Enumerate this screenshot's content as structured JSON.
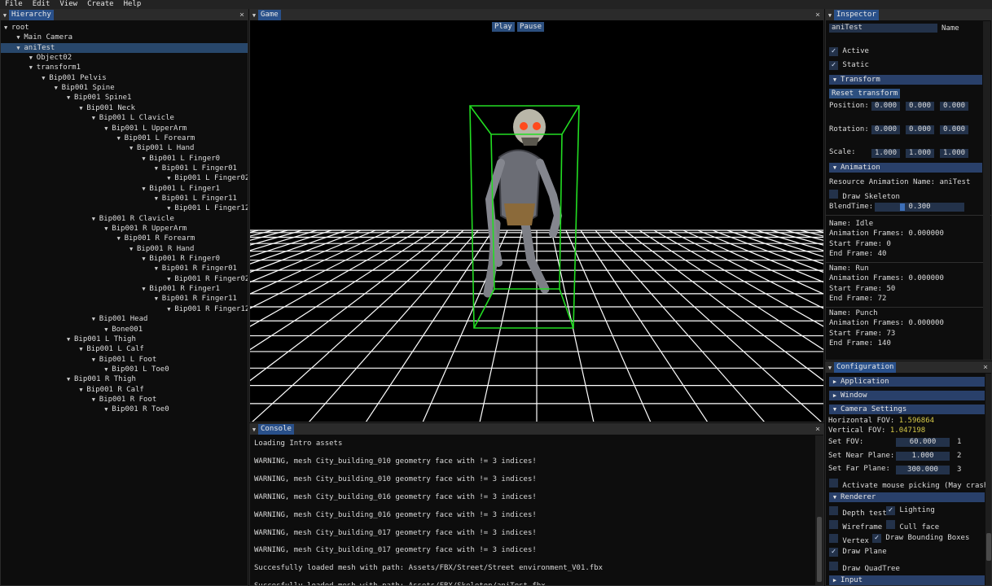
{
  "menu": [
    "File",
    "Edit",
    "View",
    "Create",
    "Help"
  ],
  "hierarchy": {
    "title": "Hierarchy",
    "nodes": [
      {
        "label": "root",
        "depth": 0
      },
      {
        "label": "Main Camera",
        "depth": 1
      },
      {
        "label": "aniTest",
        "depth": 1,
        "selected": true
      },
      {
        "label": "Object02",
        "depth": 2
      },
      {
        "label": "transform1",
        "depth": 2
      },
      {
        "label": "Bip001 Pelvis",
        "depth": 3
      },
      {
        "label": "Bip001 Spine",
        "depth": 4
      },
      {
        "label": "Bip001 Spine1",
        "depth": 5
      },
      {
        "label": "Bip001 Neck",
        "depth": 6
      },
      {
        "label": "Bip001 L Clavicle",
        "depth": 7
      },
      {
        "label": "Bip001 L UpperArm",
        "depth": 8
      },
      {
        "label": "Bip001 L Forearm",
        "depth": 9
      },
      {
        "label": "Bip001 L Hand",
        "depth": 10
      },
      {
        "label": "Bip001 L Finger0",
        "depth": 11
      },
      {
        "label": "Bip001 L Finger01",
        "depth": 12
      },
      {
        "label": "Bip001 L Finger02",
        "depth": 13
      },
      {
        "label": "Bip001 L Finger1",
        "depth": 11
      },
      {
        "label": "Bip001 L Finger11",
        "depth": 12
      },
      {
        "label": "Bip001 L Finger12",
        "depth": 13
      },
      {
        "label": "Bip001 R Clavicle",
        "depth": 7
      },
      {
        "label": "Bip001 R UpperArm",
        "depth": 8
      },
      {
        "label": "Bip001 R Forearm",
        "depth": 9
      },
      {
        "label": "Bip001 R Hand",
        "depth": 10
      },
      {
        "label": "Bip001 R Finger0",
        "depth": 11
      },
      {
        "label": "Bip001 R Finger01",
        "depth": 12
      },
      {
        "label": "Bip001 R Finger02",
        "depth": 13
      },
      {
        "label": "Bip001 R Finger1",
        "depth": 11
      },
      {
        "label": "Bip001 R Finger11",
        "depth": 12
      },
      {
        "label": "Bip001 R Finger12",
        "depth": 13
      },
      {
        "label": "Bip001 Head",
        "depth": 7
      },
      {
        "label": "Bone001",
        "depth": 8
      },
      {
        "label": "Bip001 L Thigh",
        "depth": 5
      },
      {
        "label": "Bip001 L Calf",
        "depth": 6
      },
      {
        "label": "Bip001 L Foot",
        "depth": 7
      },
      {
        "label": "Bip001 L Toe0",
        "depth": 8
      },
      {
        "label": "Bip001 R Thigh",
        "depth": 5
      },
      {
        "label": "Bip001 R Calf",
        "depth": 6
      },
      {
        "label": "Bip001 R Foot",
        "depth": 7
      },
      {
        "label": "Bip001 R Toe0",
        "depth": 8
      }
    ]
  },
  "game": {
    "title": "Game",
    "play": "Play",
    "pause": "Pause"
  },
  "console": {
    "title": "Console",
    "lines": [
      "Loading Intro assets",
      "WARNING, mesh City_building_010 geometry face with != 3 indices!",
      "WARNING, mesh City_building_010 geometry face with != 3 indices!",
      "WARNING, mesh City_building_016 geometry face with != 3 indices!",
      "WARNING, mesh City_building_016 geometry face with != 3 indices!",
      "WARNING, mesh City_building_017 geometry face with != 3 indices!",
      "WARNING, mesh City_building_017 geometry face with != 3 indices!",
      "Succesfully loaded mesh with path: Assets/FBX/Street/Street environment_V01.fbx",
      "Succesfully loaded mesh with path: Assets/FBX/Skeleton/aniTest.fbx"
    ]
  },
  "inspector": {
    "title": "Inspector",
    "name_value": "aniTest",
    "name_label": "Name",
    "active": "Active",
    "static": "Static",
    "transform_header": "Transform",
    "reset_transform": "Reset transform",
    "position_label": "Position:",
    "position": [
      "0.000",
      "0.000",
      "0.000"
    ],
    "rotation_label": "Rotation:",
    "rotation": [
      "0.000",
      "0.000",
      "0.000"
    ],
    "scale_label": "Scale:",
    "scale": [
      "1.000",
      "1.000",
      "1.000"
    ],
    "animation_header": "Animation",
    "resource_name": "Resource Animation Name: aniTest",
    "draw_skeleton": "Draw Skeleton",
    "blend_label": "BlendTime:",
    "blend_value": "0.300",
    "blend_fraction": 0.3,
    "clips": [
      {
        "name": "Name: Idle",
        "frames": "Animation Frames: 0.000000",
        "start": "Start Frame: 0",
        "end": "End Frame: 40"
      },
      {
        "name": "Name: Run",
        "frames": "Animation Frames: 0.000000",
        "start": "Start Frame: 50",
        "end": "End Frame: 72"
      },
      {
        "name": "Name: Punch",
        "frames": "Animation Frames: 0.000000",
        "start": "Start Frame: 73",
        "end": "End Frame: 140"
      }
    ]
  },
  "config": {
    "title": "Configuration",
    "application": "Application",
    "window": "Window",
    "camera_settings": "Camera Settings",
    "hfov_label": "Horizontal FOV:",
    "hfov_value": "1.596864",
    "vfov_label": "Vertical FOV:",
    "vfov_value": "1.047198",
    "set_fov_label": "Set FOV:",
    "set_fov_value": "60.000",
    "set_fov_idx": "1",
    "near_label": "Set Near Plane:",
    "near_value": "1.000",
    "near_idx": "2",
    "far_label": "Set Far Plane:",
    "far_value": "300.000",
    "far_idx": "3",
    "mouse_picking": "Activate mouse picking (May crash)",
    "renderer": "Renderer",
    "depth_test": "Depth test",
    "lighting": "Lighting",
    "wireframe": "Wireframe",
    "cull_face": "Cull face",
    "vertex": "Vertex",
    "draw_bbox": "Draw Bounding Boxes",
    "draw_plane": "Draw Plane",
    "draw_quadtree": "Draw QuadTree",
    "input": "Input"
  },
  "colors": {
    "accent": "#29508a",
    "header": "#29406a",
    "bbox": "#22dd22",
    "value_yellow": "#d6c948"
  }
}
